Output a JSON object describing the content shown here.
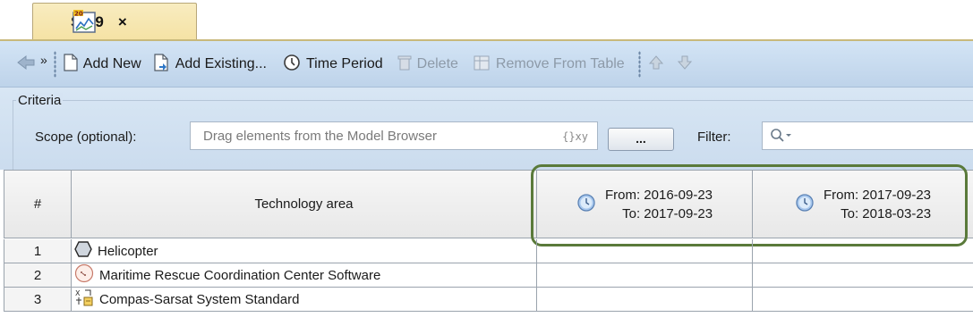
{
  "tab": {
    "title": "SV-9",
    "close": "×",
    "icon": "sv9-diagram-icon"
  },
  "toolbar": {
    "add_new": "Add New",
    "add_existing": "Add Existing...",
    "time_period": "Time Period",
    "delete": "Delete",
    "remove_from_table": "Remove From Table",
    "overflow": "»"
  },
  "criteria": {
    "title": "Criteria",
    "scope_label": "Scope (optional):",
    "scope_placeholder": "Drag elements from the Model Browser",
    "scope_var": "{}xy",
    "browse_button": "...",
    "filter_label": "Filter:"
  },
  "table": {
    "headers": {
      "num": "#",
      "area": "Technology area",
      "periods": [
        {
          "from": "From: 2016-09-23",
          "to": "To: 2017-09-23"
        },
        {
          "from": "From: 2017-09-23",
          "to": "To: 2018-03-23"
        }
      ]
    },
    "rows": [
      {
        "num": "1",
        "name": "Helicopter",
        "icon": "hexagon-icon"
      },
      {
        "num": "2",
        "name": "Maritime Rescue Coordination Center Software",
        "icon": "software-icon"
      },
      {
        "num": "3",
        "name": "Compas-Sarsat System Standard",
        "icon": "standard-icon"
      }
    ]
  },
  "colors": {
    "highlight": "#5a7a3a",
    "toolbar": "#c8dbef",
    "tab": "#f5e2a4"
  }
}
